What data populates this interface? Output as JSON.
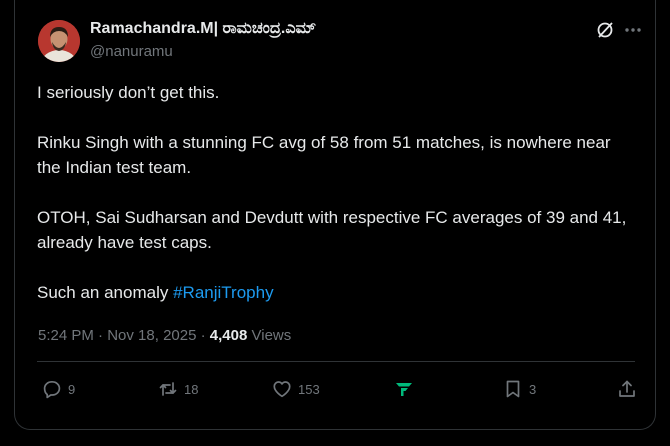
{
  "author": {
    "name": "Ramachandra.M| ರಾಮಚಂದ್ರ.ಎಮ್",
    "handle": "@nanuramu"
  },
  "tweet": {
    "paragraphs": [
      "I seriously don’t get this.",
      "Rinku Singh with a stunning FC avg of 58 from 51 matches, is nowhere near the Indian test team.",
      "OTOH, Sai Sudharsan and Devdutt with respective FC averages of 39 and 41, already have test caps."
    ],
    "last_text": "Such an anomaly ",
    "hashtag": "#RanjiTrophy"
  },
  "meta": {
    "time": "5:24 PM",
    "separator": "·",
    "date": "Nov 18, 2025",
    "views_count": "4,408",
    "views_label": "Views"
  },
  "actions": {
    "replies": "9",
    "reposts": "18",
    "likes": "153",
    "bookmarks": "3"
  },
  "colors": {
    "background": "#000000",
    "text": "#e7e9ea",
    "secondary": "#71767b",
    "link": "#1d9bf0",
    "grok_green": "#00ba7c",
    "border": "#2f3336"
  },
  "icons": [
    "grok-icon",
    "more-icon",
    "reply-icon",
    "repost-icon",
    "like-icon",
    "grok-analytics-icon",
    "bookmark-icon",
    "share-icon"
  ]
}
